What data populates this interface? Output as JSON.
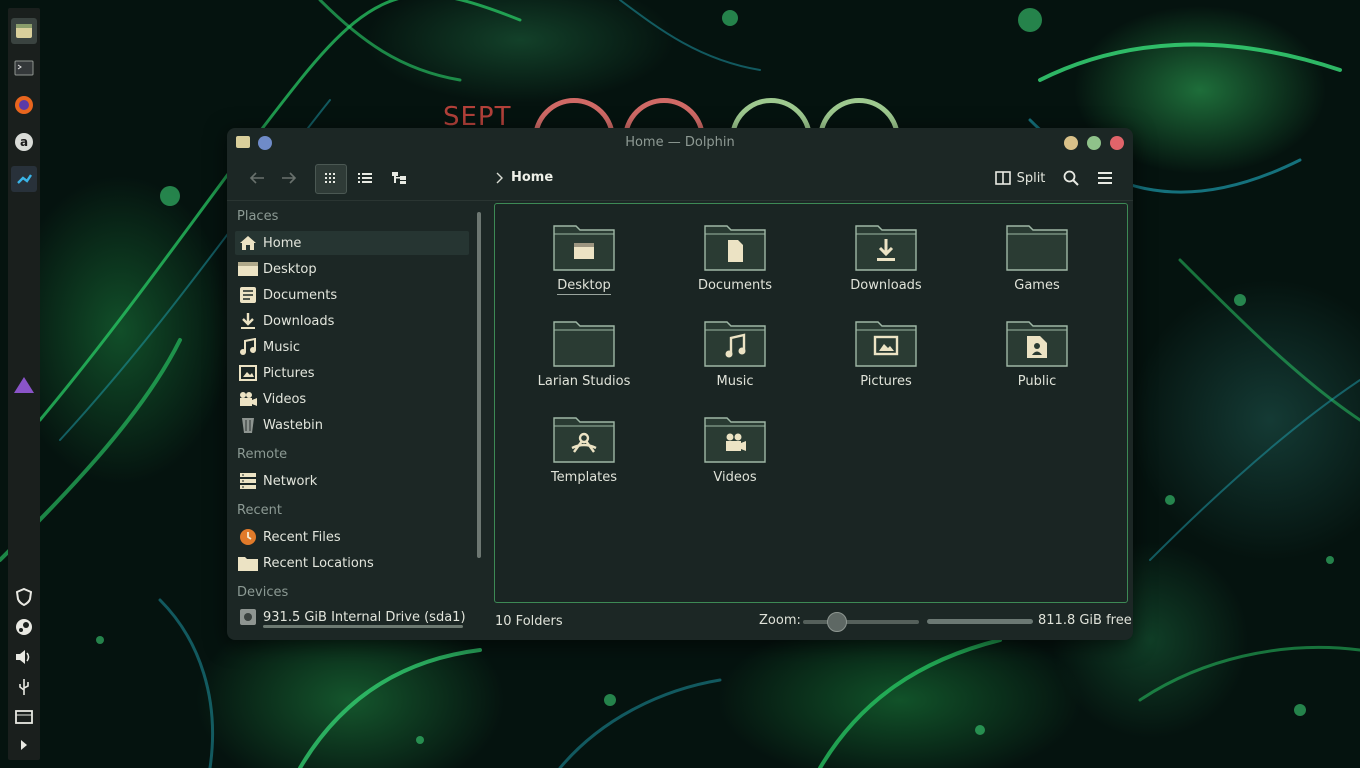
{
  "window": {
    "title": "Home — Dolphin"
  },
  "toolbar": {
    "breadcrumb": "Home",
    "split_label": "Split",
    "back_icon": "arrow-left-icon",
    "forward_icon": "arrow-right-icon",
    "view_modes": [
      "icons",
      "compact",
      "details"
    ]
  },
  "sidebar": {
    "sections": {
      "places": "Places",
      "remote": "Remote",
      "recent": "Recent",
      "devices": "Devices"
    },
    "places": [
      "Home",
      "Desktop",
      "Documents",
      "Downloads",
      "Music",
      "Pictures",
      "Videos",
      "Wastebin"
    ],
    "remote": [
      "Network"
    ],
    "recent": [
      "Recent Files",
      "Recent Locations"
    ],
    "devices": [
      "931.5 GiB Internal Drive (sda1)"
    ],
    "active": "Home"
  },
  "content": {
    "folders": [
      "Desktop",
      "Documents",
      "Downloads",
      "Games",
      "Larian Studios",
      "Music",
      "Pictures",
      "Public",
      "Templates",
      "Videos"
    ],
    "selected": "Desktop"
  },
  "status": {
    "count": "10 Folders",
    "zoom_label": "Zoom:",
    "free_space": "811.8 GiB free"
  },
  "desktop_widget": {
    "text": "SEPT"
  },
  "colors": {
    "accent_green": "#3d8a55",
    "folder_fill": "#2a3b33",
    "folder_icon_fill": "#ece3c4",
    "close": "#e0646a",
    "maximize": "#8fc28a",
    "minimize": "#d9c189"
  }
}
